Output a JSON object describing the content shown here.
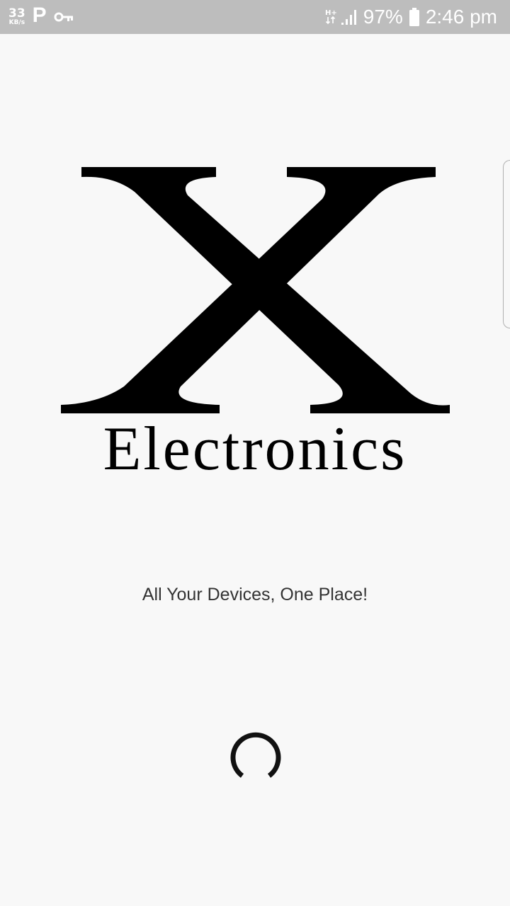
{
  "status_bar": {
    "speed_value": "33",
    "speed_unit": "KB/s",
    "parking_icon": "P",
    "network_type": "H+",
    "battery_percent": "97%",
    "time": "2:46 pm"
  },
  "splash": {
    "logo_letter": "X",
    "logo_word": "Electronics",
    "tagline": "All Your Devices, One Place!"
  },
  "colors": {
    "background": "#f8f8f8",
    "status_bar": "#bdbdbd",
    "logo": "#000000",
    "tagline": "#333333"
  }
}
